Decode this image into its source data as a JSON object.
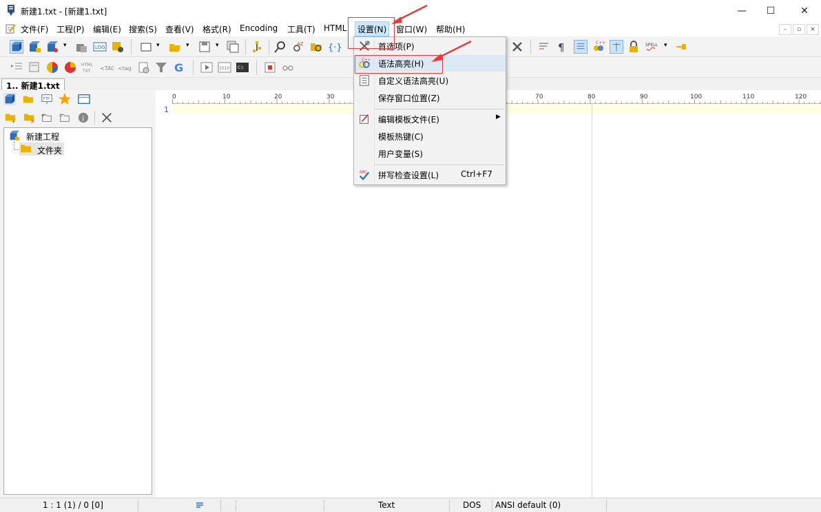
{
  "window": {
    "title": "新建1.txt - [新建1.txt]",
    "minimize": "—",
    "maximize": "☐",
    "close": "✕"
  },
  "menubar": {
    "items": [
      "文件(F)",
      "工程(P)",
      "编辑(E)",
      "搜索(S)",
      "查看(V)",
      "格式(R)",
      "Encoding",
      "工具(T)",
      "HTML",
      "设置(N)",
      "窗口(W)",
      "帮助(H)"
    ],
    "active_index": 9,
    "mdi": [
      "–",
      "▫",
      "×"
    ]
  },
  "tabs": {
    "active": "1.. 新建1.txt"
  },
  "project_tree": {
    "root": "新建工程",
    "child": "文件夹"
  },
  "editor": {
    "line_number": "1",
    "ruler_labels": [
      "0",
      "10",
      "20",
      "30",
      "70",
      "80",
      "90",
      "100",
      "110",
      "120"
    ]
  },
  "settings_menu": {
    "items": [
      {
        "label": "首选项(P)",
        "icon": "tools-icon",
        "shortcut": ""
      },
      {
        "label": "语法高亮(H)",
        "icon": "syntax-highlight-icon",
        "shortcut": ""
      },
      {
        "label": "自定义语法高亮(U)",
        "icon": "custom-syntax-icon",
        "shortcut": ""
      },
      {
        "label": "保存窗口位置(Z)",
        "icon": "",
        "shortcut": ""
      },
      {
        "label": "编辑模板文件(E)",
        "icon": "edit-template-icon",
        "shortcut": "",
        "submenu": true
      },
      {
        "label": "模板热键(C)",
        "icon": "",
        "shortcut": ""
      },
      {
        "label": "用户变量(S)",
        "icon": "",
        "shortcut": ""
      },
      {
        "label": "拼写检查设置(L)",
        "icon": "spell-check-icon",
        "shortcut": "Ctrl+F7"
      }
    ]
  },
  "statusbar": {
    "position": "1 : 1 (1) / 0  [0]",
    "mode": "Text",
    "line_ending": "DOS",
    "encoding": "ANSI default (0)"
  },
  "colors": {
    "highlight_box": "#e53b3b",
    "current_line": "#fffde2",
    "menu_active": "#cce8ff"
  }
}
